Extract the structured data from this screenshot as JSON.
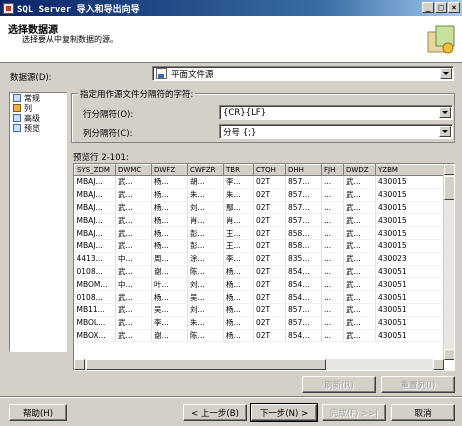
{
  "window": {
    "title": "SQL Server 导入和导出向导",
    "buttons": [
      "_",
      "□",
      "×"
    ]
  },
  "header": {
    "title": "选择数据源",
    "subtitle": "选择要从中复制数据的源。",
    "icon": "wizard-graphic-icon"
  },
  "datasource": {
    "label": "数据源(D):",
    "value": "平面文件源"
  },
  "nav": {
    "items": [
      {
        "label": "常规",
        "icon": "general-icon"
      },
      {
        "label": "列",
        "icon": "columns-icon",
        "selected": true
      },
      {
        "label": "高级",
        "icon": "advanced-icon"
      },
      {
        "label": "预览",
        "icon": "preview-icon"
      }
    ]
  },
  "delimiters": {
    "group_label": "指定用作源文件分隔符的字符:",
    "row_label": "行分隔符(O):",
    "row_value": "{CR}{LF}",
    "col_label": "列分隔符(C):",
    "col_value": "分号 {;}"
  },
  "preview": {
    "label": "预览行 2-101:",
    "columns": [
      "SYS_ZDM",
      "DWMC",
      "DWFZ",
      "CWFZR",
      "TBR",
      "CTQH",
      "DHH",
      "FJH",
      "DWDZ",
      "YZBM"
    ],
    "rows": [
      [
        "MBAJ...",
        "武...",
        "杨...",
        "胡...",
        "李...",
        "02T",
        "857...",
        "...",
        "武...",
        "430015"
      ],
      [
        "MBAJ...",
        "武...",
        "杨...",
        "朱...",
        "朱...",
        "02T",
        "857...",
        "...",
        "武...",
        "430015"
      ],
      [
        "MBAJ...",
        "武...",
        "杨...",
        "刘...",
        "鄢...",
        "02T",
        "857...",
        "...",
        "武...",
        "430015"
      ],
      [
        "MBAJ...",
        "武...",
        "杨...",
        "肖...",
        "肖...",
        "02T",
        "857...",
        "...",
        "武...",
        "430015"
      ],
      [
        "MBAJ...",
        "武...",
        "杨...",
        "彭...",
        "王...",
        "02T",
        "858...",
        "...",
        "武...",
        "430015"
      ],
      [
        "MBAJ...",
        "武...",
        "杨...",
        "彭...",
        "王...",
        "02T",
        "858...",
        "...",
        "武...",
        "430015"
      ],
      [
        "4413...",
        "中...",
        "周...",
        "涂...",
        "李...",
        "02T",
        "835...",
        "...",
        "武...",
        "430023"
      ],
      [
        "0108...",
        "武...",
        "谢...",
        "陈...",
        "杨...",
        "02T",
        "854...",
        "...",
        "武...",
        "430051"
      ],
      [
        "MBOM...",
        "中...",
        "叶...",
        "刘...",
        "杨...",
        "02T",
        "854...",
        "...",
        "武...",
        "430051"
      ],
      [
        "0108...",
        "武...",
        "杨...",
        "吴...",
        "杨...",
        "02T",
        "854...",
        "...",
        "武...",
        "430051"
      ],
      [
        "MB11...",
        "武...",
        "吴...",
        "刘...",
        "杨...",
        "02T",
        "857...",
        "...",
        "武...",
        "430051"
      ],
      [
        "MBOL...",
        "武...",
        "李...",
        "朱...",
        "杨...",
        "02T",
        "857...",
        "...",
        "武...",
        "430051"
      ],
      [
        "MBOX...",
        "武...",
        "谢...",
        "陈...",
        "杨...",
        "02T",
        "854...",
        "...",
        "武...",
        "430051"
      ]
    ]
  },
  "grid_buttons": {
    "refresh": "刷新(R)",
    "reset": "重置列(I)"
  },
  "footer": {
    "help": "帮助(H)",
    "back": "< 上一步(B)",
    "next": "下一步(N) >",
    "finish": "完成(F) >>|",
    "cancel": "取消"
  }
}
